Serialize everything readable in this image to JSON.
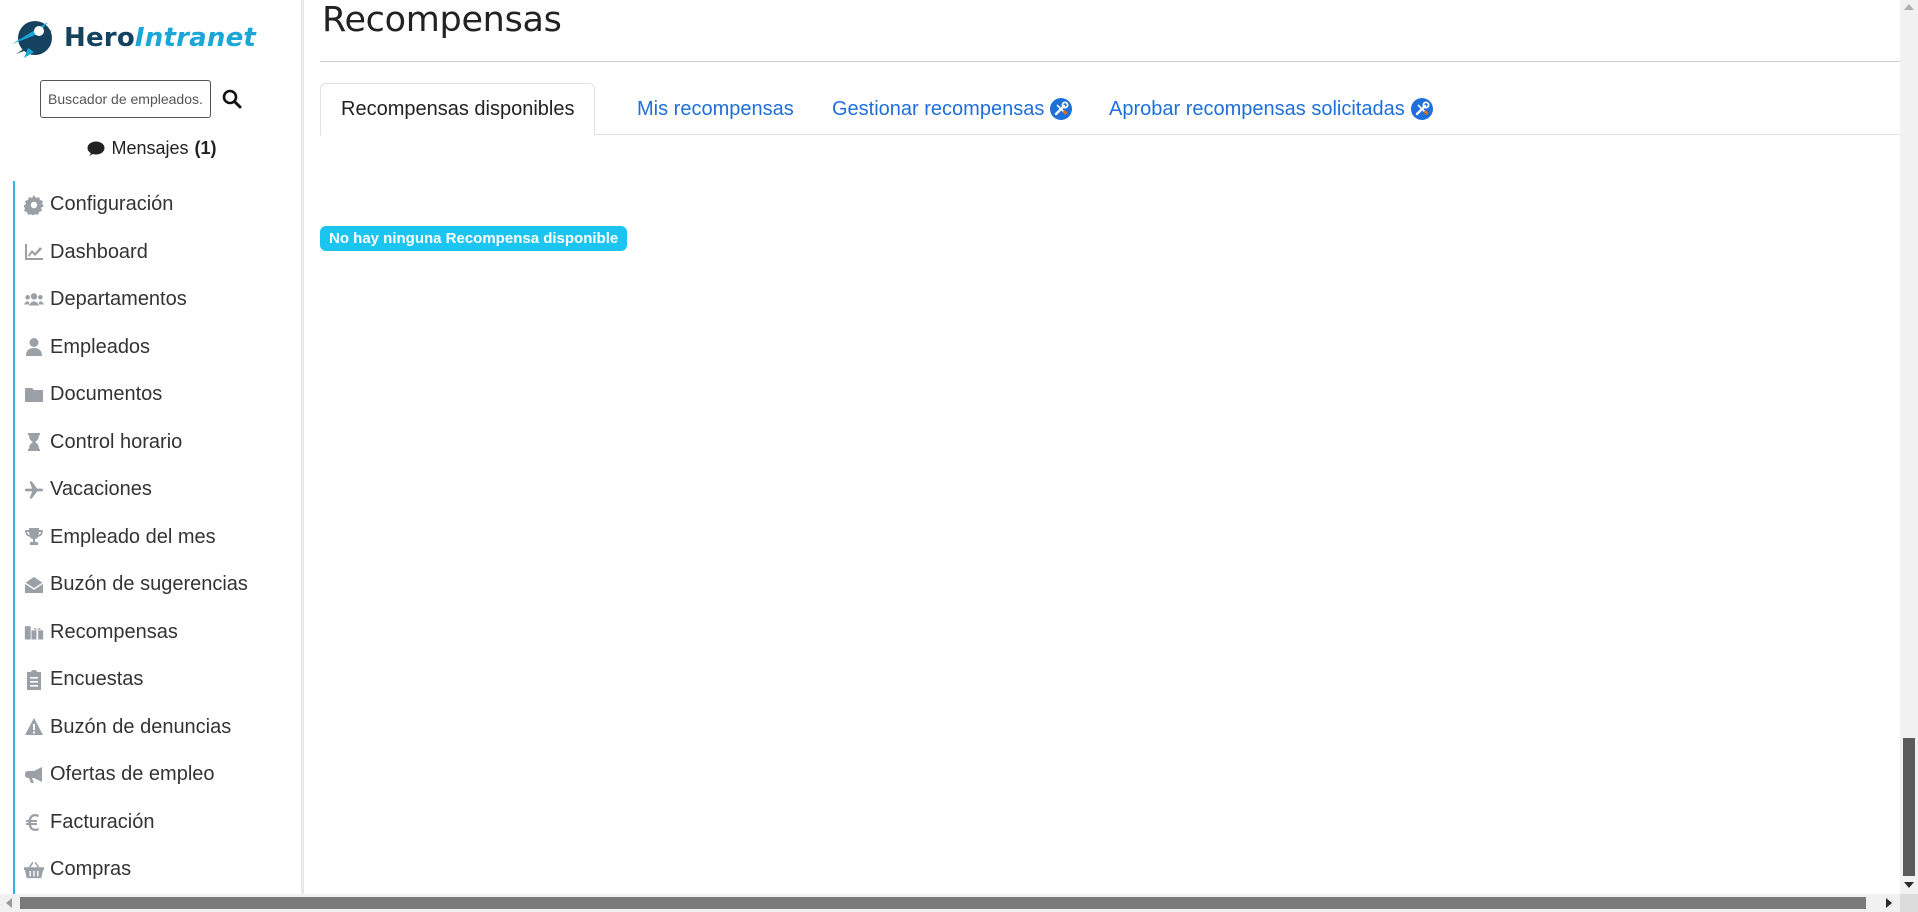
{
  "brand": {
    "part1": "Hero",
    "part2": "Intranet"
  },
  "search": {
    "placeholder": "Buscador de empleados..."
  },
  "messages": {
    "label": "Mensajes",
    "count": "(1)"
  },
  "sidebar": {
    "items": [
      {
        "label": "Configuración",
        "icon": "gear-icon"
      },
      {
        "label": "Dashboard",
        "icon": "chart-line-icon"
      },
      {
        "label": "Departamentos",
        "icon": "users-icon"
      },
      {
        "label": "Empleados",
        "icon": "user-icon"
      },
      {
        "label": "Documentos",
        "icon": "folder-icon"
      },
      {
        "label": "Control horario",
        "icon": "hourglass-icon"
      },
      {
        "label": "Vacaciones",
        "icon": "plane-icon"
      },
      {
        "label": "Empleado del mes",
        "icon": "trophy-icon"
      },
      {
        "label": "Buzón de sugerencias",
        "icon": "envelope-open-icon"
      },
      {
        "label": "Recompensas",
        "icon": "gifts-icon"
      },
      {
        "label": "Encuestas",
        "icon": "clipboard-list-icon"
      },
      {
        "label": "Buzón de denuncias",
        "icon": "warning-icon"
      },
      {
        "label": "Ofertas de empleo",
        "icon": "megaphone-icon"
      },
      {
        "label": "Facturación",
        "icon": "euro-icon"
      },
      {
        "label": "Compras",
        "icon": "basket-icon"
      }
    ]
  },
  "main": {
    "title": "Recompensas",
    "tabs": [
      {
        "label": "Recompensas disponibles",
        "active": true
      },
      {
        "label": "Mis recompensas",
        "active": false
      },
      {
        "label": "Gestionar recompensas",
        "active": false,
        "admin_icon": "tools-icon"
      },
      {
        "label": "Aprobar recompensas solicitadas",
        "active": false,
        "admin_icon": "tools-icon"
      }
    ],
    "empty_badge": "No hay ninguna Recompensa disponible"
  },
  "colors": {
    "accent": "#1cc4f0",
    "link": "#1e6fd9",
    "brand_dark": "#15425e",
    "brand_light": "#1aa7d8",
    "nav_border": "#2fb5e0"
  }
}
